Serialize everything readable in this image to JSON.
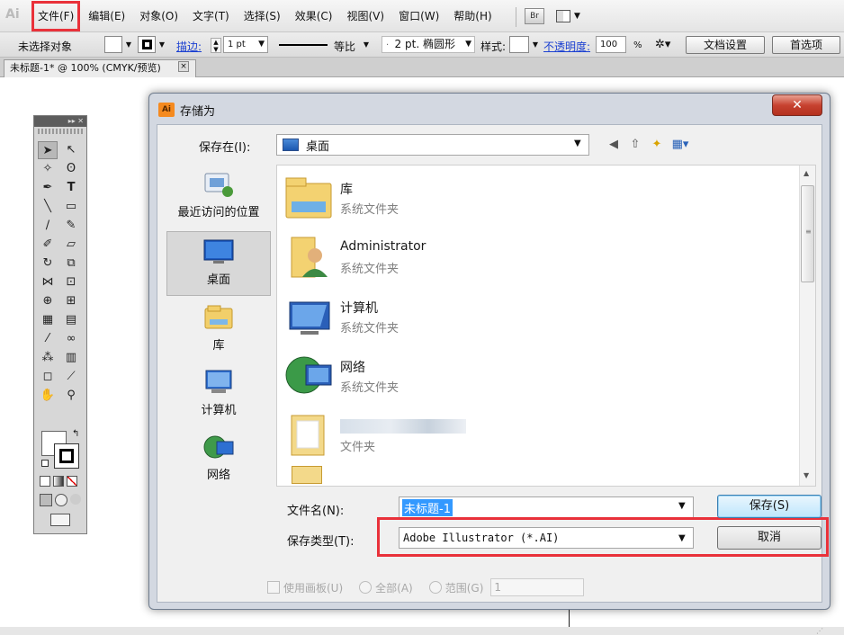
{
  "menubar": {
    "app_logo": "Ai",
    "items": [
      "文件(F)",
      "编辑(E)",
      "对象(O)",
      "文字(T)",
      "选择(S)",
      "效果(C)",
      "视图(V)",
      "窗口(W)",
      "帮助(H)"
    ],
    "bridge_label": "Br"
  },
  "controlbar": {
    "selection_status": "未选择对象",
    "stroke_label": "描边:",
    "stroke_weight": "1 pt",
    "stroke_style": "等比",
    "brush_label": "2 pt. 椭圆形",
    "style_label": "样式:",
    "opacity_label": "不透明度:",
    "opacity_value": "100",
    "opacity_unit": "%",
    "doc_setup_button": "文档设置",
    "preferences_button": "首选项"
  },
  "document_tab": {
    "title": "未标题-1* @ 100% (CMYK/预览)",
    "close_glyph": "×"
  },
  "dialog": {
    "title": "存储为",
    "close_glyph": "✕",
    "save_in_label": "保存在(I):",
    "save_in_value": "桌面",
    "places": [
      {
        "label": "最近访问的位置",
        "icon": "recent-places-icon"
      },
      {
        "label": "桌面",
        "icon": "desktop-icon"
      },
      {
        "label": "库",
        "icon": "libraries-icon"
      },
      {
        "label": "计算机",
        "icon": "computer-icon"
      },
      {
        "label": "网络",
        "icon": "network-icon"
      }
    ],
    "files": [
      {
        "name": "库",
        "type": "系统文件夹",
        "icon": "libraries-folder-icon"
      },
      {
        "name": "Administrator",
        "type": "系统文件夹",
        "icon": "user-folder-icon"
      },
      {
        "name": "计算机",
        "type": "系统文件夹",
        "icon": "computer-icon"
      },
      {
        "name": "网络",
        "type": "系统文件夹",
        "icon": "network-icon"
      },
      {
        "name": "",
        "type": "文件夹",
        "icon": "folder-icon"
      }
    ],
    "filename_label": "文件名(N):",
    "filename_value": "未标题-1",
    "savetype_label": "保存类型(T):",
    "savetype_value": "Adobe Illustrator (*.AI)",
    "save_button": "保存(S)",
    "cancel_button": "取消",
    "use_artboards": "使用画板(U)",
    "all_label": "全部(A)",
    "range_label": "范围(G)",
    "range_value": "1"
  },
  "colors": {
    "highlight_red": "#e9313a",
    "selection_blue": "#3399ff"
  }
}
